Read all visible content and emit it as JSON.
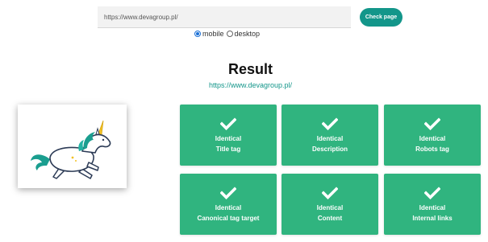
{
  "search": {
    "url_value": "https://www.devagroup.pl/",
    "button_label": "Check page"
  },
  "device": {
    "options": [
      {
        "label": "mobile",
        "selected": true
      },
      {
        "label": "desktop",
        "selected": false
      }
    ]
  },
  "result": {
    "title": "Result",
    "url": "https://www.devagroup.pl/"
  },
  "tiles": [
    {
      "status": "Identical",
      "label": "Title tag",
      "icon": "check-icon"
    },
    {
      "status": "Identical",
      "label": "Description",
      "icon": "check-icon"
    },
    {
      "status": "Identical",
      "label": "Robots tag",
      "icon": "check-icon"
    },
    {
      "status": "Identical",
      "label": "Canonical tag target",
      "icon": "check-icon"
    },
    {
      "status": "Identical",
      "label": "Content",
      "icon": "check-icon"
    },
    {
      "status": "Identical",
      "label": "Internal links",
      "icon": "check-icon"
    }
  ],
  "colors": {
    "accent": "#13968a",
    "tile": "#30b47f",
    "link": "#13968a"
  },
  "image": {
    "icon": "unicorn-icon"
  }
}
